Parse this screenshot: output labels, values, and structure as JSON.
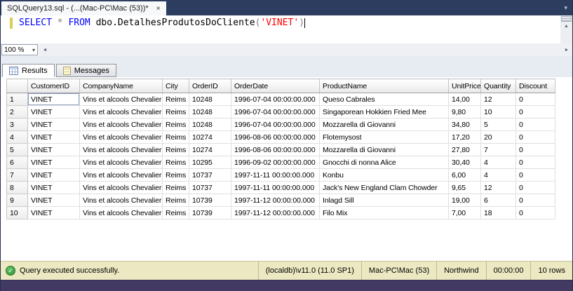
{
  "window": {
    "tab_title": "SQLQuery13.sql - (...(Mac-PC\\Mac (53))*"
  },
  "icons": {
    "close": "×",
    "dropdown_arrow": "▾",
    "check": "✓",
    "scroll_left": "◄",
    "scroll_right": "►",
    "scroll_up": "▲"
  },
  "editor": {
    "zoom": "100 %",
    "sql_tokens": [
      {
        "type": "keyword",
        "text": "SELECT"
      },
      {
        "type": "operator",
        "text": " * "
      },
      {
        "type": "keyword",
        "text": "FROM"
      },
      {
        "type": "plain",
        "text": " dbo.DetalhesProdutosDoCliente"
      },
      {
        "type": "paren",
        "text": "("
      },
      {
        "type": "string",
        "text": "'VINET'"
      },
      {
        "type": "paren",
        "text": ")"
      }
    ]
  },
  "results_pane": {
    "tabs": [
      {
        "label": "Results"
      },
      {
        "label": "Messages"
      }
    ]
  },
  "grid": {
    "columns": [
      "CustomerID",
      "CompanyName",
      "City",
      "OrderID",
      "OrderDate",
      "ProductName",
      "UnitPrice",
      "Quantity",
      "Discount"
    ],
    "rows": [
      [
        "VINET",
        "Vins et alcools Chevalier",
        "Reims",
        "10248",
        "1996-07-04 00:00:00.000",
        "Queso Cabrales",
        "14,00",
        "12",
        "0"
      ],
      [
        "VINET",
        "Vins et alcools Chevalier",
        "Reims",
        "10248",
        "1996-07-04 00:00:00.000",
        "Singaporean Hokkien Fried Mee",
        "9,80",
        "10",
        "0"
      ],
      [
        "VINET",
        "Vins et alcools Chevalier",
        "Reims",
        "10248",
        "1996-07-04 00:00:00.000",
        "Mozzarella di Giovanni",
        "34,80",
        "5",
        "0"
      ],
      [
        "VINET",
        "Vins et alcools Chevalier",
        "Reims",
        "10274",
        "1996-08-06 00:00:00.000",
        "Flotemysost",
        "17,20",
        "20",
        "0"
      ],
      [
        "VINET",
        "Vins et alcools Chevalier",
        "Reims",
        "10274",
        "1996-08-06 00:00:00.000",
        "Mozzarella di Giovanni",
        "27,80",
        "7",
        "0"
      ],
      [
        "VINET",
        "Vins et alcools Chevalier",
        "Reims",
        "10295",
        "1996-09-02 00:00:00.000",
        "Gnocchi di nonna Alice",
        "30,40",
        "4",
        "0"
      ],
      [
        "VINET",
        "Vins et alcools Chevalier",
        "Reims",
        "10737",
        "1997-11-11 00:00:00.000",
        "Konbu",
        "6,00",
        "4",
        "0"
      ],
      [
        "VINET",
        "Vins et alcools Chevalier",
        "Reims",
        "10737",
        "1997-11-11 00:00:00.000",
        "Jack's New England Clam Chowder",
        "9,65",
        "12",
        "0"
      ],
      [
        "VINET",
        "Vins et alcools Chevalier",
        "Reims",
        "10739",
        "1997-11-12 00:00:00.000",
        "Inlagd Sill",
        "19,00",
        "6",
        "0"
      ],
      [
        "VINET",
        "Vins et alcools Chevalier",
        "Reims",
        "10739",
        "1997-11-12 00:00:00.000",
        "Filo Mix",
        "7,00",
        "18",
        "0"
      ]
    ]
  },
  "status_bar": {
    "message": "Query executed successfully.",
    "server": "(localdb)\\v11.0 (11.0 SP1)",
    "login": "Mac-PC\\Mac (53)",
    "database": "Northwind",
    "duration": "00:00:00",
    "rows": "10 rows"
  },
  "colors": {
    "keyword": "#0000FF",
    "string_literal": "#FF0000",
    "title_strip": "#2C3D5F",
    "bottom_strip": "#423A63",
    "status_bar_bg": "#ECE9C2",
    "success_green": "#2F9235"
  }
}
